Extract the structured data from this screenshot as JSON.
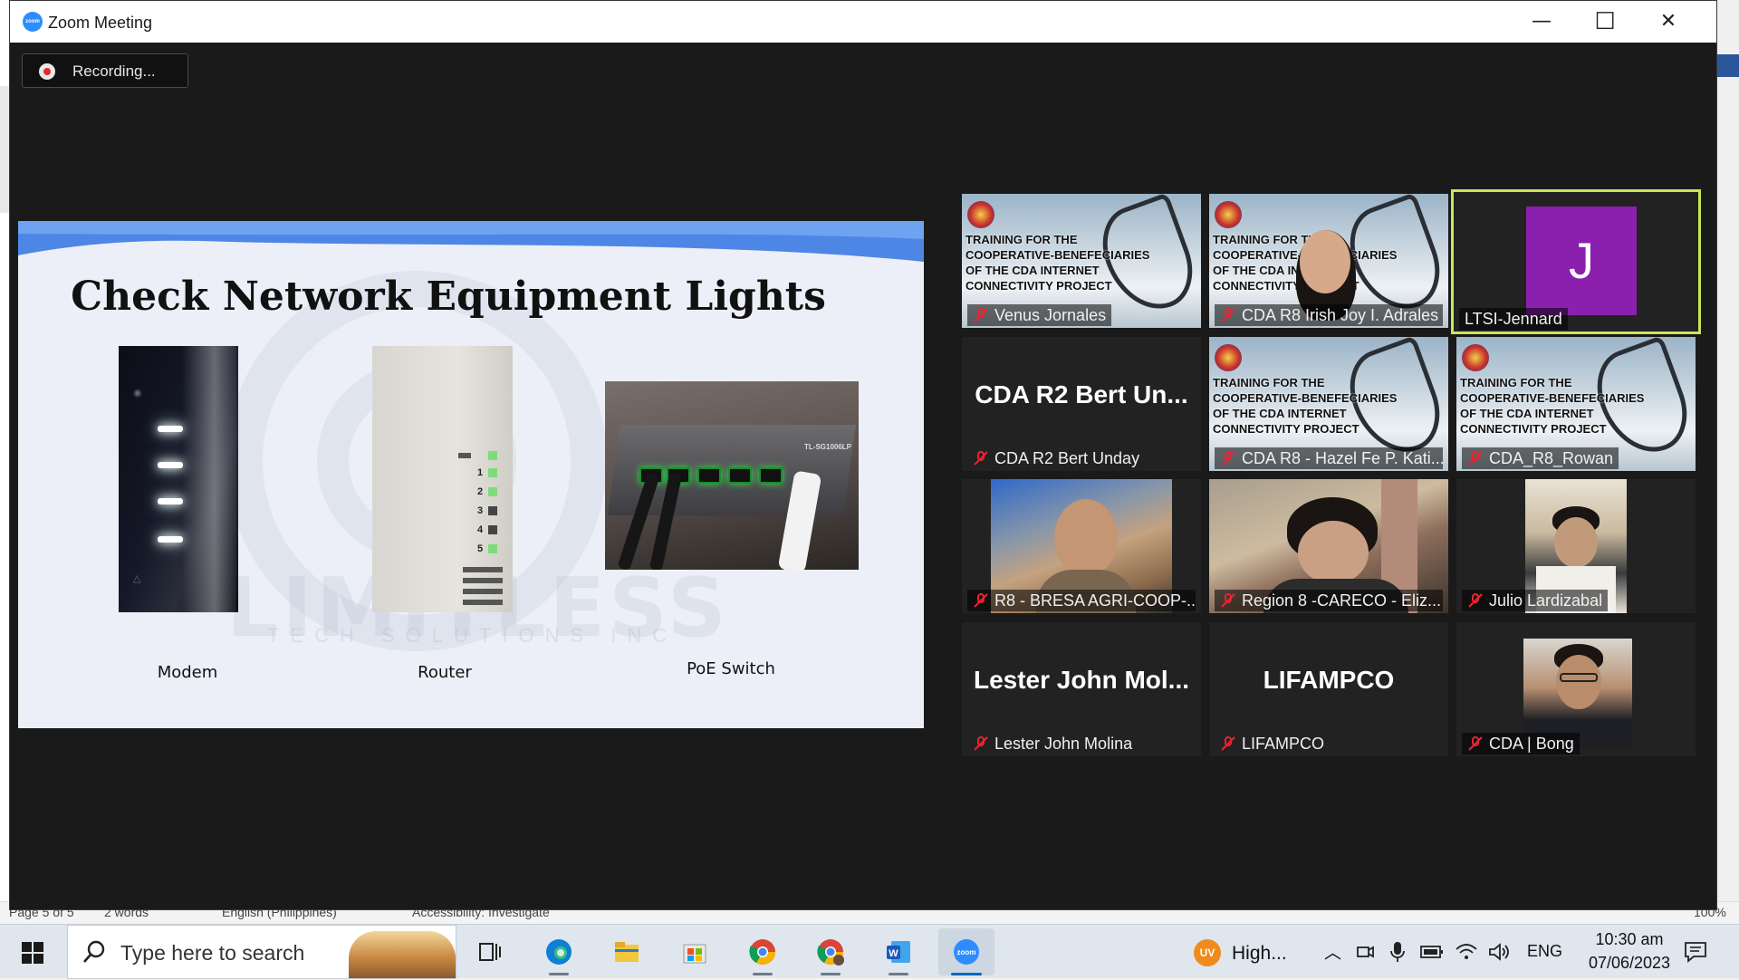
{
  "window": {
    "title": "Zoom Meeting",
    "minimize": "—",
    "maximize": "☐",
    "close": "✕",
    "recording_label": "Recording..."
  },
  "slide": {
    "title": "Check Network Equipment Lights",
    "captions": [
      "Modem",
      "Router",
      "PoE Switch"
    ],
    "watermark": "LIMITLESS",
    "watermark_sub": "TECH SOLUTIONS INC",
    "router_ports": [
      "1",
      "2",
      "3",
      "4",
      "5"
    ],
    "poe_label": "TL-SG1006LP"
  },
  "banner_text": [
    "TRAINING FOR THE",
    "COOPERATIVE-BENEFECIARIES",
    "OF THE CDA INTERNET",
    "CONNECTIVITY PROJECT"
  ],
  "participants": [
    {
      "name": "Venus Jornales",
      "type": "banner"
    },
    {
      "name": "CDA R8 Irish Joy I. Adrales",
      "type": "banner-woman"
    },
    {
      "name": "LTSI-Jennard",
      "type": "avatar",
      "initial": "J",
      "avatar_color": "#8b1fae",
      "highlight": "#c8e65a"
    },
    {
      "name": "CDA R2 Bert Unday",
      "type": "text",
      "display": "CDA R2 Bert Un..."
    },
    {
      "name": "CDA R8 - Hazel Fe P. Kati...",
      "type": "banner"
    },
    {
      "name": "CDA_R8_Rowan",
      "type": "banner"
    },
    {
      "name": "R8 - BRESA AGRI-COOP-...",
      "type": "video"
    },
    {
      "name": "Region 8 -CARECO  - Eliz...",
      "type": "video"
    },
    {
      "name": "Julio Lardizabal",
      "type": "video"
    },
    {
      "name": "Lester John Molina",
      "type": "text",
      "display": "Lester John Mol..."
    },
    {
      "name": "LIFAMPCO",
      "type": "text",
      "display": "LIFAMPCO"
    },
    {
      "name": "CDA | Bong",
      "type": "video"
    }
  ],
  "word_status": {
    "page": "Page 5 of 5",
    "words": "2 words",
    "language": "English (Philippines)",
    "accessibility": "Accessibility: Investigate",
    "zoom": "100%"
  },
  "taskbar": {
    "search_placeholder": "Type here to search",
    "weather": "High...",
    "weather_badge": "UV",
    "language": "ENG",
    "time": "10:30 am",
    "date": "07/06/2023",
    "zoom_label": "zoom",
    "word_label": "W"
  },
  "colors": {
    "zoom_blue": "#2d8cff",
    "record_red": "#e02b2b",
    "active_speaker": "#c8e65a",
    "taskbar_bg": "#dfe6ee"
  }
}
